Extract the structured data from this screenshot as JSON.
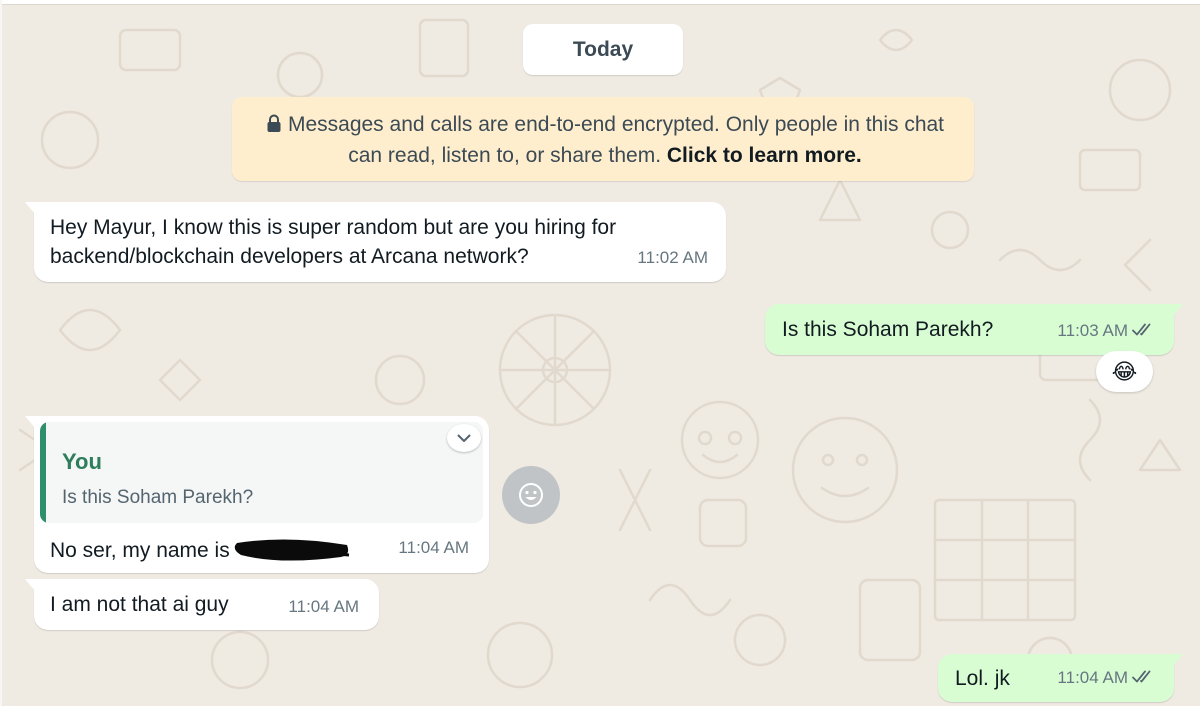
{
  "colors": {
    "wallpaper": "#efeae2",
    "incoming_bubble": "#ffffff",
    "outgoing_bubble": "#d9fdd3",
    "encryption_notice": "#ffeecd",
    "quote_accent": "#2f8f6a",
    "read_ticks": "#54656f"
  },
  "date_divider": "Today",
  "encryption_notice": {
    "icon": "lock-icon",
    "text": "Messages and calls are end-to-end encrypted. Only people in this chat can read, listen to, or share them.",
    "link": "Click to learn more."
  },
  "messages": [
    {
      "direction": "incoming",
      "text": "Hey Mayur, I know this is super random but are you hiring for backend/blockchain developers at Arcana network?",
      "time": "11:02 AM"
    },
    {
      "direction": "outgoing",
      "text": "Is this Soham Parekh?",
      "time": "11:03 AM",
      "status": "read",
      "reaction": "😂"
    },
    {
      "direction": "incoming",
      "reply_to": {
        "author": "You",
        "text": "Is this Soham Parekh?"
      },
      "text": "No ser, my name is",
      "redacted": true,
      "time": "11:04 AM",
      "menu_icon": "chevron-down-icon"
    },
    {
      "direction": "incoming",
      "text": "I am not that ai guy",
      "time": "11:04 AM"
    },
    {
      "direction": "outgoing",
      "text": "Lol. jk",
      "time": "11:04 AM",
      "status": "read"
    }
  ],
  "emoji_button_icon": "smiley-icon"
}
